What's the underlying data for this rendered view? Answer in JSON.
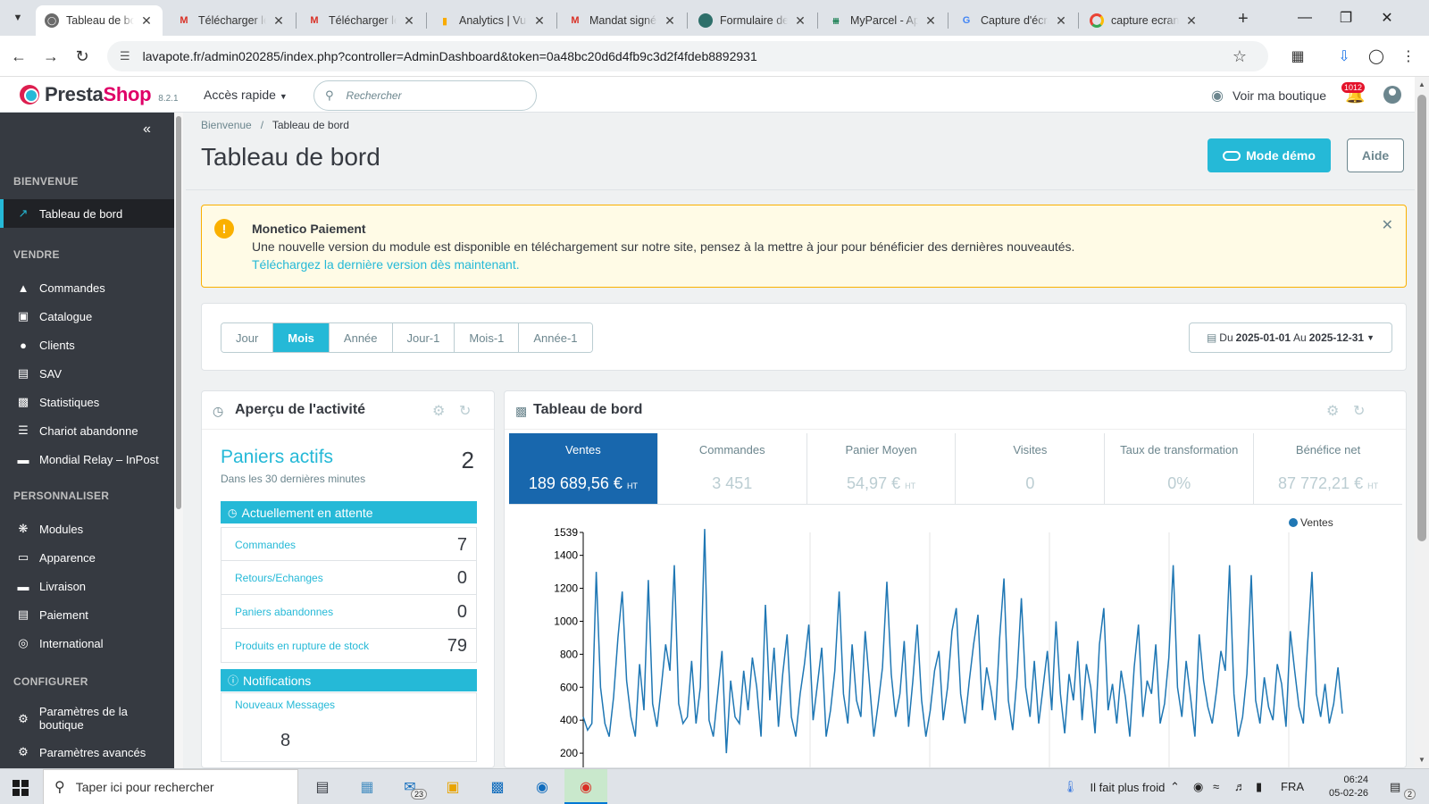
{
  "browser": {
    "tabs": [
      {
        "title": "Tableau de bord",
        "favicon": "prestashop"
      },
      {
        "title": "Télécharger le",
        "favicon": "gmail"
      },
      {
        "title": "Télécharger le",
        "favicon": "gmail"
      },
      {
        "title": "Analytics | Vue",
        "favicon": "analytics"
      },
      {
        "title": "Mandat signé",
        "favicon": "gmail"
      },
      {
        "title": "Formulaire de",
        "favicon": "form"
      },
      {
        "title": "MyParcel - Ap",
        "favicon": "myparcel"
      },
      {
        "title": "Capture d'écra",
        "favicon": "google"
      },
      {
        "title": "capture ecran",
        "favicon": "chrome"
      }
    ],
    "url": "lavapote.fr/admin020285/index.php?controller=AdminDashboard&token=0a48bc20d6d4fb9c3d2f4fdeb8892931"
  },
  "header": {
    "brand_pre": "Presta",
    "brand_post": "Shop",
    "version": "8.2.1",
    "quick_access": "Accès rapide",
    "search_placeholder": "Rechercher",
    "shop_link": "Voir ma boutique",
    "notif_count": "1012"
  },
  "sidebar": {
    "sections": {
      "bienvenue": "BIENVENUE",
      "vendre": "VENDRE",
      "personnaliser": "PERSONNALISER",
      "configurer": "CONFIGURER"
    },
    "items": {
      "dashboard": "Tableau de bord",
      "orders": "Commandes",
      "catalog": "Catalogue",
      "customers": "Clients",
      "sav": "SAV",
      "stats": "Statistiques",
      "cart": "Chariot abandonne",
      "mondial": "Mondial Relay – InPost",
      "modules": "Modules",
      "appearance": "Apparence",
      "shipping": "Livraison",
      "payment": "Paiement",
      "international": "International",
      "shop_params": "Paramètres de la boutique",
      "advanced": "Paramètres avancés"
    }
  },
  "page": {
    "breadcrumb_home": "Bienvenue",
    "breadcrumb_current": "Tableau de bord",
    "title": "Tableau de bord",
    "demo_button": "Mode démo",
    "help_button": "Aide"
  },
  "alert": {
    "title": "Monetico Paiement",
    "message": "Une nouvelle version du module est disponible en téléchargement sur notre site, pensez à la mettre à jour pour bénéficier des dernières nouveautés.",
    "link": "Téléchargez la dernière version dès maintenant."
  },
  "period": {
    "buttons": [
      "Jour",
      "Mois",
      "Année",
      "Jour-1",
      "Mois-1",
      "Année-1"
    ],
    "active": "Mois",
    "from_label": "Du",
    "from": "2025-01-01",
    "to_label": "Au",
    "to": "2025-12-31"
  },
  "activity": {
    "title": "Aperçu de l'activité",
    "active_carts_label": "Paniers actifs",
    "active_carts_value": "2",
    "active_carts_sub": "Dans les 30 dernières minutes",
    "pending_title": "Actuellement en attente",
    "pending": [
      {
        "label": "Commandes",
        "value": "7"
      },
      {
        "label": "Retours/Echanges",
        "value": "0"
      },
      {
        "label": "Paniers abandonnes",
        "value": "0"
      },
      {
        "label": "Produits en rupture de stock",
        "value": "79"
      }
    ],
    "notifications_title": "Notifications",
    "new_messages_label": "Nouveaux Messages",
    "new_messages_value": "8"
  },
  "dashboard": {
    "title": "Tableau de bord",
    "kpis": [
      {
        "label": "Ventes",
        "value": "189 689,56 €",
        "suffix": "HT",
        "selected": true
      },
      {
        "label": "Commandes",
        "value": "3 451",
        "suffix": ""
      },
      {
        "label": "Panier Moyen",
        "value": "54,97 €",
        "suffix": "HT"
      },
      {
        "label": "Visites",
        "value": "0",
        "suffix": ""
      },
      {
        "label": "Taux de transformation",
        "value": "0%",
        "suffix": ""
      },
      {
        "label": "Bénéfice net",
        "value": "87 772,21 €",
        "suffix": "HT"
      }
    ]
  },
  "chart_data": {
    "type": "line",
    "title": "",
    "xlabel": "",
    "ylabel": "",
    "legend": "top-right",
    "grid": true,
    "ylim": [
      0,
      1539
    ],
    "yticks": [
      200,
      400,
      600,
      800,
      1000,
      1200,
      1400,
      1539
    ],
    "series": [
      {
        "name": "Ventes",
        "color": "#1f77b4",
        "values": [
          420,
          340,
          380,
          1300,
          600,
          380,
          300,
          540,
          900,
          1180,
          640,
          420,
          300,
          740,
          460,
          1250,
          500,
          360,
          600,
          860,
          700,
          1340,
          500,
          380,
          420,
          760,
          380,
          600,
          1560,
          400,
          300,
          560,
          820,
          200,
          640,
          420,
          380,
          700,
          460,
          780,
          600,
          300,
          1100,
          520,
          840,
          360,
          680,
          920,
          420,
          300,
          560,
          740,
          980,
          400,
          620,
          840,
          300,
          460,
          700,
          1180,
          560,
          380,
          860,
          520,
          420,
          940,
          620,
          300,
          500,
          720,
          1240,
          680,
          420,
          560,
          880,
          360,
          640,
          980,
          520,
          300,
          460,
          700,
          820,
          400,
          600,
          940,
          1080,
          560,
          380,
          640,
          860,
          1040,
          460,
          720,
          580,
          400,
          900,
          1260,
          520,
          340,
          660,
          1140,
          600,
          420,
          760,
          380,
          600,
          820,
          460,
          1000,
          560,
          320,
          680,
          520,
          880,
          400,
          740,
          600,
          320,
          860,
          1080,
          460,
          620,
          380,
          700,
          540,
          300,
          720,
          980,
          420,
          640,
          560,
          860,
          380,
          500,
          780,
          1340,
          600,
          420,
          760,
          540,
          300,
          920,
          640,
          480,
          380,
          580,
          820,
          700,
          1340,
          560,
          300,
          420,
          680,
          1280,
          520,
          380,
          660,
          480,
          400,
          740,
          620,
          360,
          940,
          700,
          480,
          380,
          860,
          1300,
          560,
          420,
          620,
          380,
          500,
          720,
          440
        ]
      }
    ]
  }
}
